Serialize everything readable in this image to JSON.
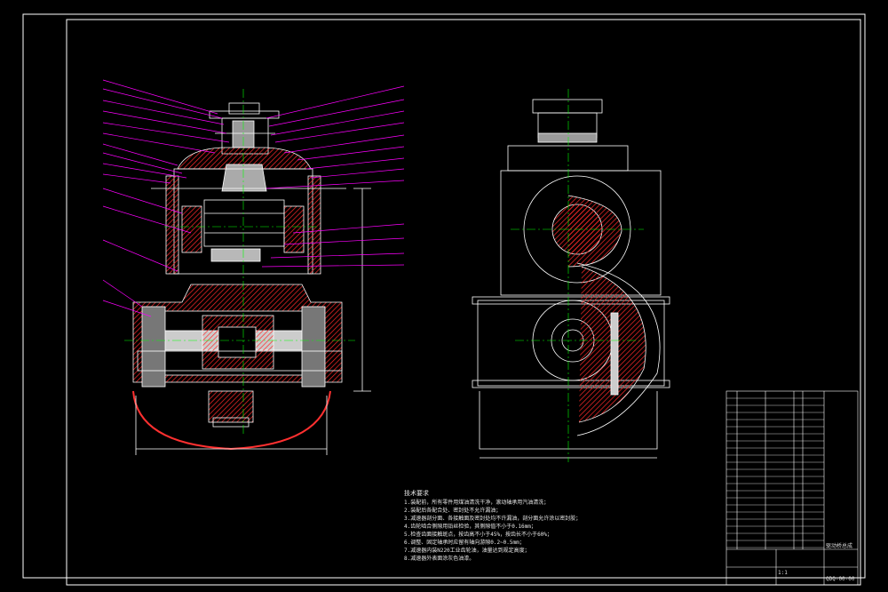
{
  "notes": {
    "title": "技术要求",
    "items": [
      "1.装配前，所有零件用煤油清洗干净，滚动轴承用汽油清洗；",
      "2.装配后各配合处、密封处不允许漏油；",
      "3.减速器剖分面、各接触面及密封处均不许漏油，剖分面允许涂以密封胶；",
      "4.齿轮啮合侧隙用铅丝检验，其侧隙值不小于0.16mm；",
      "5.检查齿面接触斑点，按齿高不小于45%，按齿长不小于60%；",
      "6.调整、固定轴承时应留有轴向游隙0.2~0.5mm；",
      "7.减速器内装N220工业齿轮油，油量达到规定高度；",
      "8.减速器外表面涂灰色油漆。"
    ]
  },
  "title_block": {
    "name": "驱动桥总成",
    "code": "QDQ-00-00",
    "scale": "1:1"
  },
  "colors": {
    "background": "#000000",
    "frame": "#ffffff",
    "leaders": "#ff00ff",
    "hatch": "#ff2020",
    "centerline": "#00ff00",
    "dimension": "#ffffff",
    "shading": "#8a8a8a"
  }
}
